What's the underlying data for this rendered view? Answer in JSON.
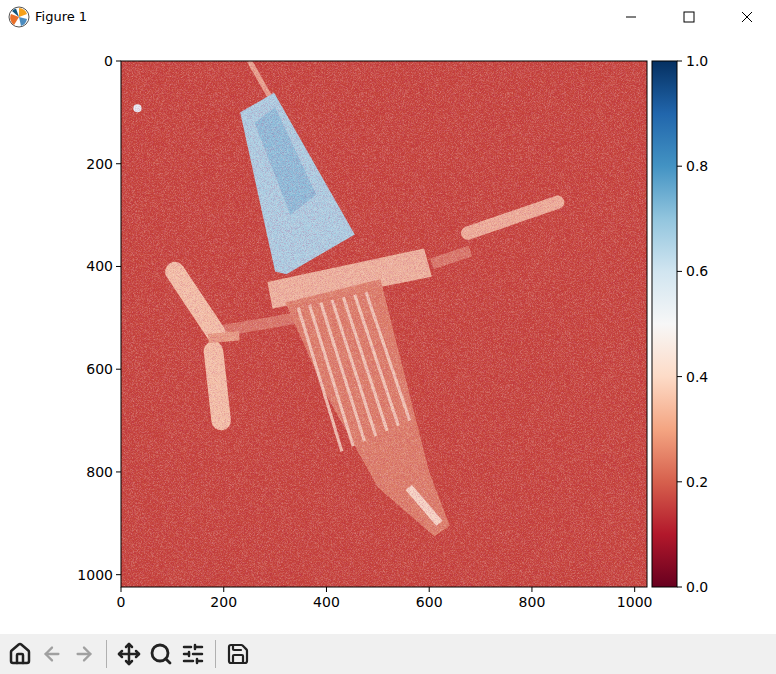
{
  "window": {
    "title": "Figure 1"
  },
  "plot": {
    "x_ticks": [
      "0",
      "200",
      "400",
      "600",
      "800",
      "1000"
    ],
    "y_ticks": [
      "0",
      "200",
      "400",
      "600",
      "800",
      "1000"
    ],
    "image_size": "1024"
  },
  "colorbar": {
    "ticks": [
      "0.0",
      "0.2",
      "0.4",
      "0.6",
      "0.8",
      "1.0"
    ]
  },
  "toolbar": {
    "back": {
      "disabled": true
    },
    "forward": {
      "disabled": true
    }
  }
}
